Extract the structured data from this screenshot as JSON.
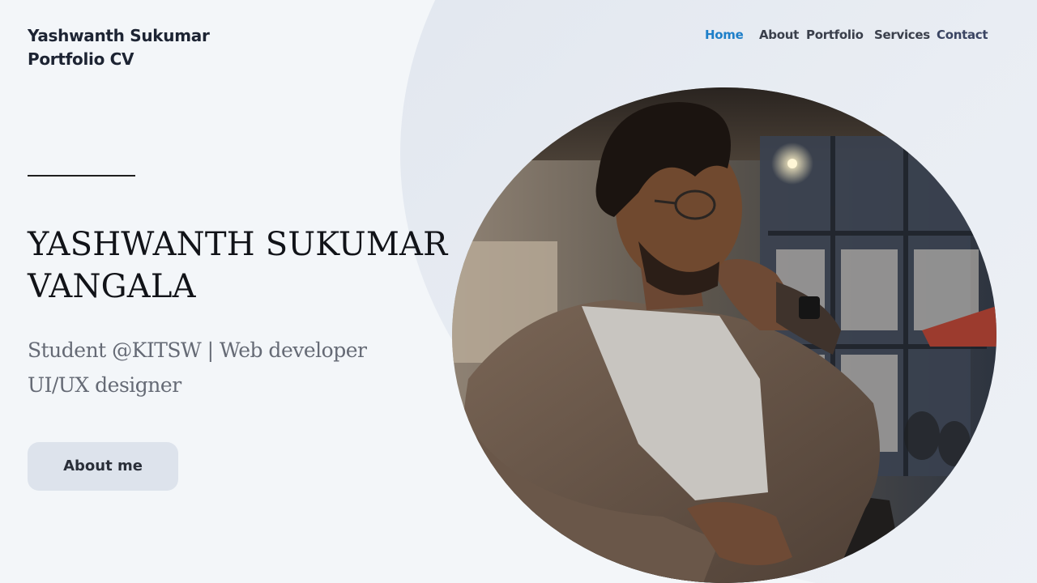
{
  "brand": {
    "line1": "Yashwanth Sukumar",
    "line2": "Portfolio CV"
  },
  "nav": {
    "items": [
      {
        "label": "Home",
        "active": true
      },
      {
        "label": "About",
        "active": false
      },
      {
        "label": "Portfolio",
        "active": false
      },
      {
        "label": "Services",
        "active": false
      },
      {
        "label": "Contact",
        "active": false
      }
    ]
  },
  "hero": {
    "name_line1": "YASHWANTH SUKUMAR",
    "name_line2": "VANGALA",
    "tagline_line1": "Student @KITSW | Web developer",
    "tagline_line2": "UI/UX designer",
    "about_button": "About me"
  },
  "profile_photo": {
    "icon": "portrait-photo"
  },
  "colors": {
    "background": "#f3f6f9",
    "accent": "#1e7fc9",
    "button_bg": "#dde3ec",
    "heading": "#111318",
    "subtext": "#656a75"
  }
}
